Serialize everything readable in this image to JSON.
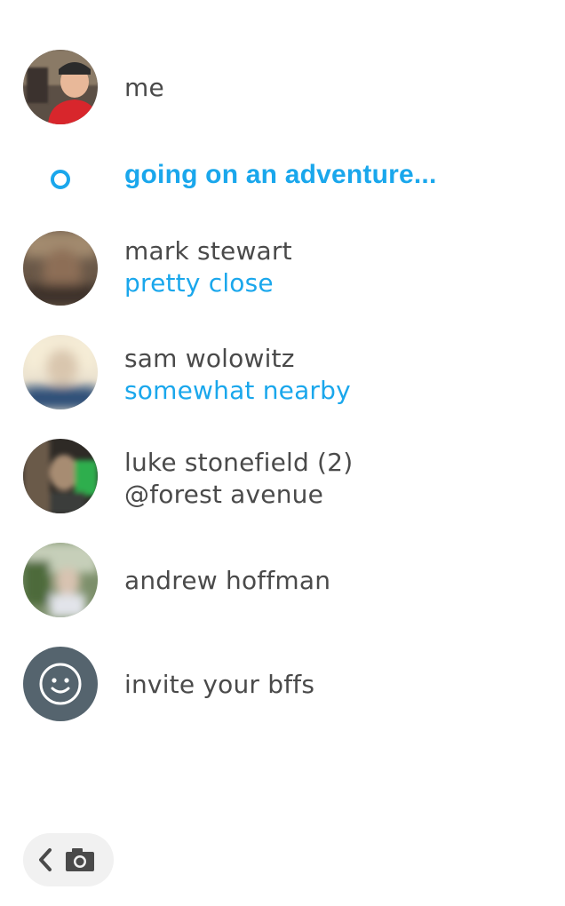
{
  "colors": {
    "accent": "#1aa7ec",
    "text": "#4a4a4a",
    "invite_avatar_bg": "#55646e"
  },
  "me": {
    "name": "me"
  },
  "status": {
    "text": "going on an adventure..."
  },
  "friends": [
    {
      "name": "mark stewart",
      "detail": "pretty close",
      "detail_color": "#1aa7ec"
    },
    {
      "name": "sam wolowitz",
      "detail": "somewhat nearby",
      "detail_color": "#1aa7ec"
    },
    {
      "name": "luke stonefield (2)",
      "detail": "@forest avenue",
      "detail_color": "#4a4a4a"
    },
    {
      "name": "andrew hoffman"
    }
  ],
  "invite": {
    "label": "invite your bffs",
    "icon": "smiley-icon"
  },
  "bottom_button": {
    "icons": [
      "chevron-left-icon",
      "camera-icon"
    ]
  }
}
